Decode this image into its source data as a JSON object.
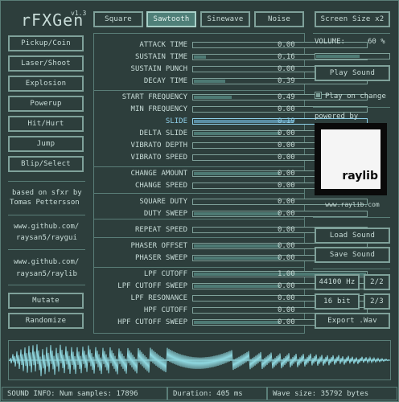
{
  "app": {
    "title": "rFXGen",
    "version": "v1.3"
  },
  "presets": [
    "Pickup/Coin",
    "Laser/Shoot",
    "Explosion",
    "Powerup",
    "Hit/Hurt",
    "Jump",
    "Blip/Select"
  ],
  "credits": {
    "line1": "based on sfxr by",
    "line2": "Tomas Pettersson",
    "link1a": "www.github.com/",
    "link1b": "raysan5/raygui",
    "link2a": "www.github.com/",
    "link2b": "raysan5/raylib"
  },
  "actions": {
    "mutate": "Mutate",
    "randomize": "Randomize"
  },
  "waves": {
    "square": "Square",
    "sawtooth": "Sawtooth",
    "sinewave": "Sinewave",
    "noise": "Noise",
    "selected": "Sawtooth"
  },
  "params": {
    "attack_time": {
      "label": "ATTACK TIME",
      "value": "0.00",
      "level": 0.0
    },
    "sustain_time": {
      "label": "SUSTAIN TIME",
      "value": "0.16",
      "level": 0.07
    },
    "sustain_punch": {
      "label": "SUSTAIN PUNCH",
      "value": "0.00",
      "level": 0.0
    },
    "decay_time": {
      "label": "DECAY TIME",
      "value": "0.39",
      "level": 0.18
    },
    "start_frequency": {
      "label": "START FREQUENCY",
      "value": "0.49",
      "level": 0.22
    },
    "min_frequency": {
      "label": "MIN FREQUENCY",
      "value": "0.00",
      "level": 0.0
    },
    "slide": {
      "label": "SLIDE",
      "value": "0.19",
      "level": 0.58
    },
    "delta_slide": {
      "label": "DELTA SLIDE",
      "value": "0.00",
      "level": 0.5
    },
    "vibrato_depth": {
      "label": "VIBRATO DEPTH",
      "value": "0.00",
      "level": 0.0
    },
    "vibrato_speed": {
      "label": "VIBRATO SPEED",
      "value": "0.00",
      "level": 0.0
    },
    "change_amount": {
      "label": "CHANGE AMOUNT",
      "value": "0.00",
      "level": 0.5
    },
    "change_speed": {
      "label": "CHANGE SPEED",
      "value": "0.00",
      "level": 0.0
    },
    "square_duty": {
      "label": "SQUARE DUTY",
      "value": "0.00",
      "level": 0.0
    },
    "duty_sweep": {
      "label": "DUTY SWEEP",
      "value": "0.00",
      "level": 0.5
    },
    "repeat_speed": {
      "label": "REPEAT SPEED",
      "value": "0.00",
      "level": 0.0
    },
    "phaser_offset": {
      "label": "PHASER OFFSET",
      "value": "0.00",
      "level": 0.5
    },
    "phaser_sweep": {
      "label": "PHASER SWEEP",
      "value": "0.00",
      "level": 0.5
    },
    "lpf_cutoff": {
      "label": "LPF CUTOFF",
      "value": "1.00",
      "level": 1.0
    },
    "lpf_cutoff_sweep": {
      "label": "LPF CUTOFF SWEEP",
      "value": "0.00",
      "level": 0.5
    },
    "lpf_resonance": {
      "label": "LPF RESONANCE",
      "value": "0.00",
      "level": 0.0
    },
    "hpf_cutoff": {
      "label": "HPF CUTOFF",
      "value": "0.00",
      "level": 0.0
    },
    "hpf_cutoff_sweep": {
      "label": "HPF CUTOFF SWEEP",
      "value": "0.00",
      "level": 0.5
    }
  },
  "right": {
    "screen_size": "Screen Size x2",
    "volume_label": "VOLUME:",
    "volume_value": "60 %",
    "volume_level": 0.6,
    "play_sound": "Play Sound",
    "play_on_change": "Play on change",
    "play_on_change_checked": true,
    "powered_by": "powered by",
    "logo_text": "raylib",
    "logo_url": "www.raylib.com",
    "load_sound": "Load Sound",
    "save_sound": "Save Sound",
    "sample_rate": "44100 Hz",
    "sample_rate_toggle": "2/2",
    "bit_depth": "16 bit",
    "bit_depth_toggle": "2/3",
    "export": "Export .Wav"
  },
  "status": {
    "info": "SOUND INFO: Num samples: 17896",
    "duration": "Duration: 405 ms",
    "wave_size": "Wave size: 35792 bytes"
  },
  "colors": {
    "bg": "#2d3e3c",
    "border": "#7fa19a",
    "fill": "#4e7a74",
    "highlight": "#8fd0ea",
    "wave": "#8fd8e0",
    "active_button": "#4f7f78"
  }
}
